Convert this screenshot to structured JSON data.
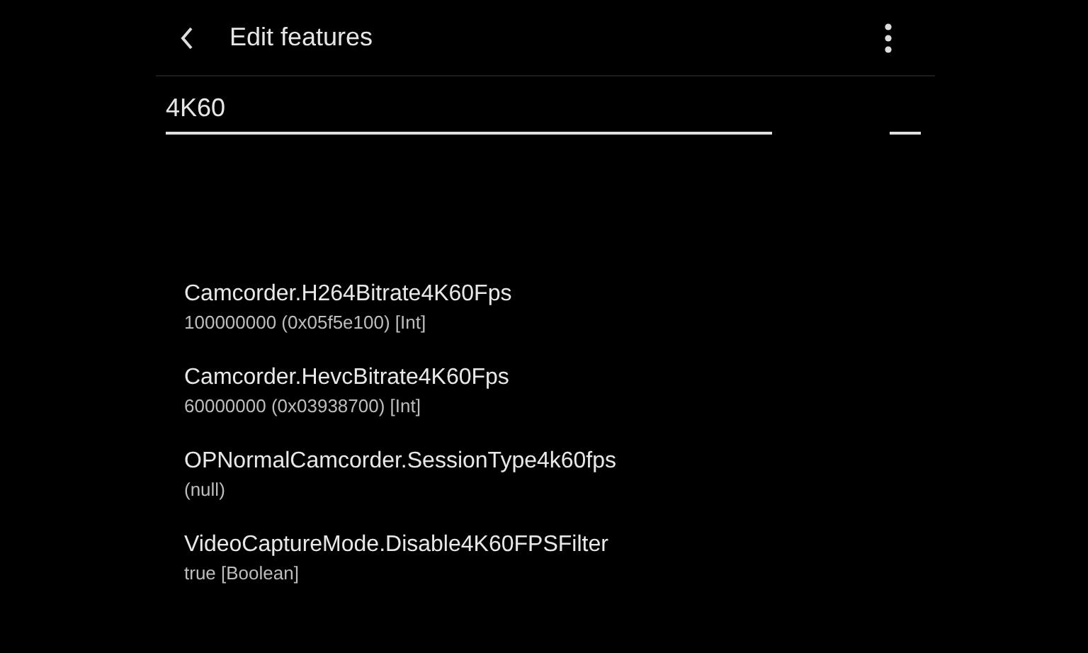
{
  "app_bar": {
    "title": "Edit features"
  },
  "search": {
    "value": "4K60"
  },
  "features": [
    {
      "name": "Camcorder.H264Bitrate4K60Fps",
      "value": "100000000 (0x05f5e100) [Int]"
    },
    {
      "name": "Camcorder.HevcBitrate4K60Fps",
      "value": "60000000 (0x03938700) [Int]"
    },
    {
      "name": "OPNormalCamcorder.SessionType4k60fps",
      "value": "(null)"
    },
    {
      "name": "VideoCaptureMode.Disable4K60FPSFilter",
      "value": "true [Boolean]"
    }
  ]
}
